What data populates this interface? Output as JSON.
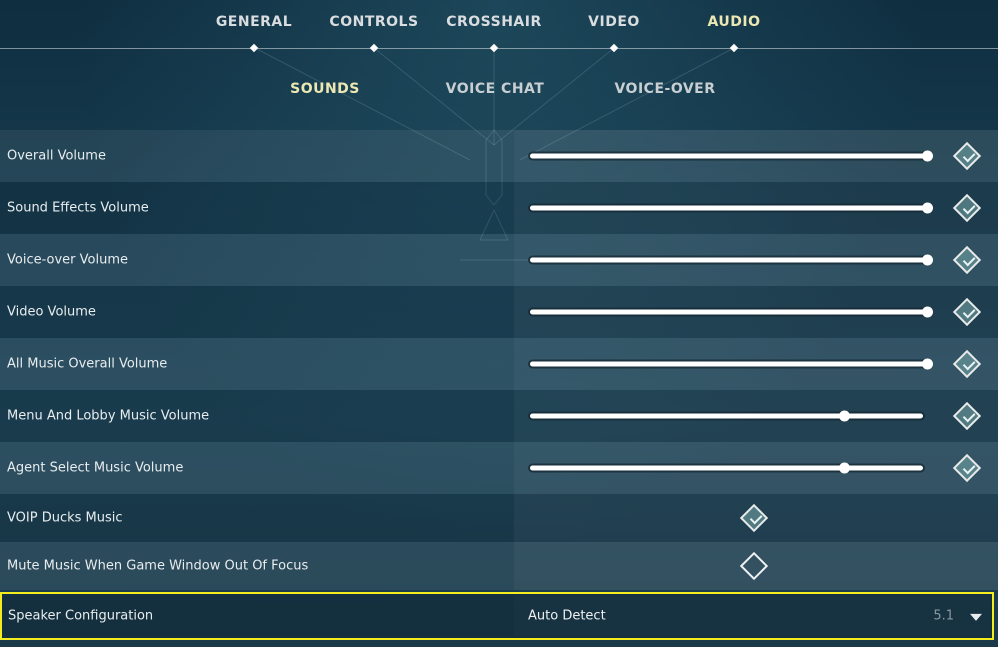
{
  "tabs": [
    {
      "label": "GENERAL",
      "active": false
    },
    {
      "label": "CONTROLS",
      "active": false
    },
    {
      "label": "CROSSHAIR",
      "active": false
    },
    {
      "label": "VIDEO",
      "active": false
    },
    {
      "label": "AUDIO",
      "active": true
    }
  ],
  "subtabs": [
    {
      "label": "SOUNDS",
      "active": true
    },
    {
      "label": "VOICE CHAT",
      "active": false
    },
    {
      "label": "VOICE-OVER",
      "active": false
    }
  ],
  "sliders": [
    {
      "label": "Overall Volume",
      "value": 1.0
    },
    {
      "label": "Sound Effects Volume",
      "value": 1.0
    },
    {
      "label": "Voice-over Volume",
      "value": 1.0
    },
    {
      "label": "Video Volume",
      "value": 1.0
    },
    {
      "label": "All Music Overall Volume",
      "value": 1.0
    },
    {
      "label": "Menu And Lobby Music Volume",
      "value": 0.8
    },
    {
      "label": "Agent Select Music Volume",
      "value": 0.8
    }
  ],
  "toggles": [
    {
      "label": "VOIP Ducks Music",
      "checked": true
    },
    {
      "label": "Mute Music When Game Window Out Of Focus",
      "checked": false
    }
  ],
  "speaker": {
    "label": "Speaker Configuration",
    "value": "Auto Detect",
    "hint": "5.1"
  },
  "colors": {
    "active_tab": "#ece8b3",
    "highlight_border": "#f5ec1f"
  }
}
